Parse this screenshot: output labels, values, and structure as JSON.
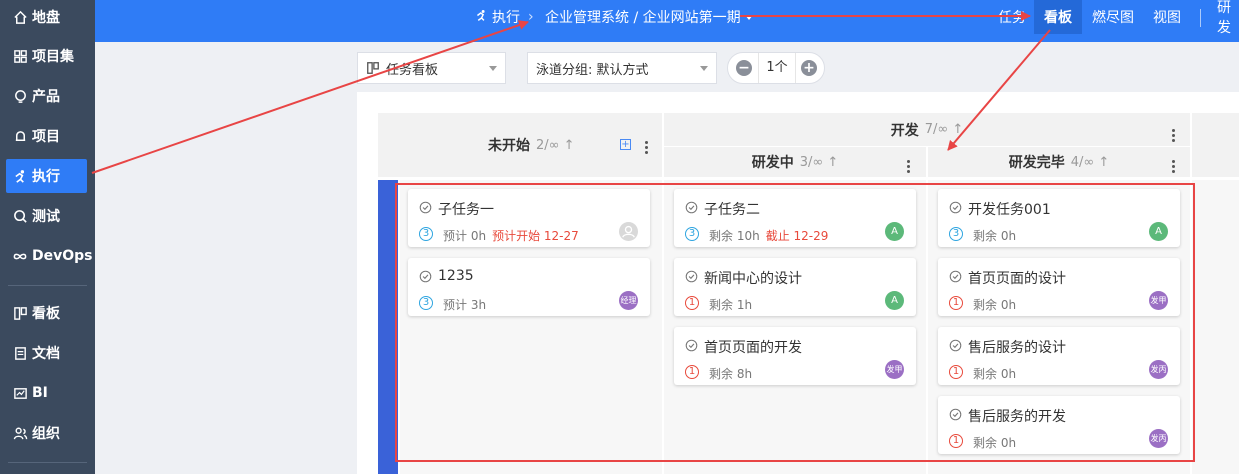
{
  "sidebar": {
    "items": [
      {
        "label": "地盘",
        "icon": "home-icon"
      },
      {
        "label": "项目集",
        "icon": "grid-icon"
      },
      {
        "label": "产品",
        "icon": "bulb-icon"
      },
      {
        "label": "项目",
        "icon": "bell-icon"
      },
      {
        "label": "执行",
        "icon": "run-icon",
        "active": true
      },
      {
        "label": "测试",
        "icon": "search-icon"
      },
      {
        "label": "DevOps",
        "icon": "infinity-icon"
      },
      {
        "label": "看板",
        "icon": "kanban-icon"
      },
      {
        "label": "文档",
        "icon": "doc-icon"
      },
      {
        "label": "BI",
        "icon": "chart-icon"
      },
      {
        "label": "组织",
        "icon": "people-icon"
      }
    ]
  },
  "header": {
    "module": "执行",
    "separator": "›",
    "breadcrumb": "企业管理系统 / 企业网站第一期",
    "tabs": [
      "任务",
      "看板",
      "燃尽图",
      "视图",
      "研发"
    ],
    "active_tab": "看板"
  },
  "toolbar": {
    "view_select": "任务看板",
    "lane_select": "泳道分组: 默认方式",
    "stepper_value": "1个",
    "minus": "−",
    "plus": "+"
  },
  "board": {
    "columns": {
      "todo": {
        "title": "未开始",
        "count": "2/∞"
      },
      "dev": {
        "title": "开发",
        "count": "7/∞"
      },
      "developing": {
        "title": "研发中",
        "count": "3/∞"
      },
      "developed": {
        "title": "研发完毕",
        "count": "4/∞"
      }
    },
    "todo_cards": [
      {
        "title": "子任务一",
        "priority": "3",
        "meta": "预计 0h",
        "extra": "预计开始 12-27",
        "avatar": ""
      },
      {
        "title": "1235",
        "priority": "3",
        "meta": "预计 3h",
        "extra": "",
        "avatar": "经理"
      }
    ],
    "developing_cards": [
      {
        "title": "子任务二",
        "priority": "3",
        "meta": "剩余 10h",
        "extra": "截止 12-29",
        "avatar": "A"
      },
      {
        "title": "新闻中心的设计",
        "priority": "1",
        "meta": "剩余 1h",
        "extra": "",
        "avatar": "A"
      },
      {
        "title": "首页页面的开发",
        "priority": "1",
        "meta": "剩余 8h",
        "extra": "",
        "avatar": "发甲"
      }
    ],
    "developed_cards": [
      {
        "title": "开发任务001",
        "priority": "3",
        "meta": "剩余 0h",
        "extra": "",
        "avatar": "A"
      },
      {
        "title": "首页页面的设计",
        "priority": "1",
        "meta": "剩余 0h",
        "extra": "",
        "avatar": "发甲"
      },
      {
        "title": "售后服务的设计",
        "priority": "1",
        "meta": "剩余 0h",
        "extra": "",
        "avatar": "发丙"
      },
      {
        "title": "售后服务的开发",
        "priority": "1",
        "meta": "剩余 0h",
        "extra": "",
        "avatar": "发丙"
      }
    ]
  },
  "colors": {
    "primary": "#2f7cf6",
    "sidebar": "#3b4a5e",
    "annotation": "#e84545",
    "lane": "#3a62d8"
  }
}
